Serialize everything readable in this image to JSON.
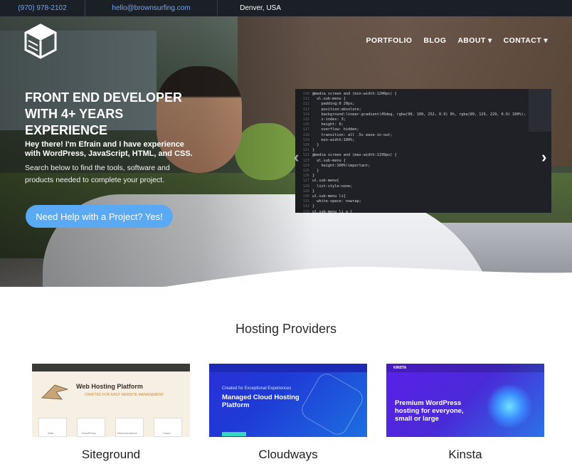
{
  "topbar": {
    "phone": "(970) 978-2102",
    "email": "hello@brownsurfing.com",
    "location": "Denver, USA"
  },
  "nav": {
    "items": [
      {
        "label": "PORTFOLIO"
      },
      {
        "label": "BLOG"
      },
      {
        "label": "ABOUT ▾"
      },
      {
        "label": "CONTACT ▾"
      }
    ]
  },
  "hero": {
    "headline": "FRONT END DEVELOPER WITH 4+ YEARS EXPERIENCE",
    "intro": "Hey there! I'm Efrain and I have experience with WordPress, JavaScript, HTML, and CSS.",
    "search_text": "Search below to find the tools, software and products needed to complete your project.",
    "cta": "Need Help with a Project? Yes!",
    "code_gutter": "110\n111\n112\n113\n114\n115\n116\n117\n118\n119\n120\n121\n122\n123\n124\n125\n126\n127\n128\n129\n130\n131\n132\n133",
    "code_lines": "@media screen and (min-width:1200px) {\n  ul.sub-menu {\n    padding:0 20px;\n    position:absolute;\n    background:linear-gradient(45deg, rgba(90, 109, 252, 0.9) 0%, rgba(89, 129, 229, 0.9) 100%);\n    z-index: 3;\n    height: 0;\n    overflow: hidden;\n    transition: all .5s ease-in-out;\n    min-width:100%;\n  }\n}\n@media screen and (max-width:1199px) {\n  ul.sub-menu {\n    height:100%!important;\n  }\n}\nul.sub-menu{\n  list-style:none;\n}\nul.sub-menu li{\n  white-space: nowrap;\n}\nul.sub-menu li a {\n  color:black;"
  },
  "section": {
    "title": "Hosting Providers"
  },
  "providers": [
    {
      "name": "Siteground",
      "shot_title": "Web Hosting Platform",
      "shot_subtitle": "CRAFTED FOR EASY WEBSITE MANAGEMENT",
      "boxes": [
        "Web",
        "WordPress",
        "WooCommerce",
        "Cloud"
      ]
    },
    {
      "name": "Cloudways",
      "shot_kicker": "Created for Exceptional Experiences",
      "shot_title": "Managed Cloud Hosting Platform"
    },
    {
      "name": "Kinsta",
      "shot_logo": "KINSTA",
      "shot_title": "Premium WordPress hosting for everyone, small or large"
    }
  ],
  "colors": {
    "topbar_bg": "#1b1f26",
    "link": "#6ea6ff",
    "cta_bg": "#5aa9f4"
  },
  "icons": {
    "logo": "cube-logo-icon",
    "prev": "chevron-left-icon",
    "next": "chevron-right-icon"
  }
}
